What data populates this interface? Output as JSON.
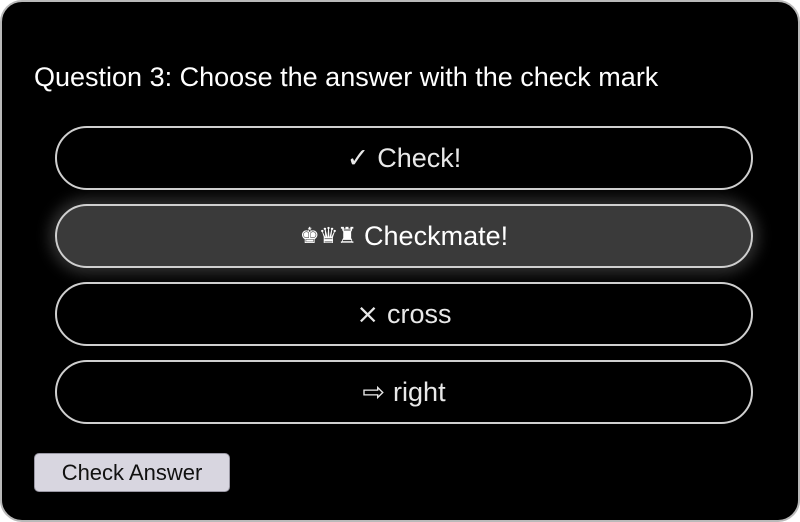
{
  "question": {
    "title": "Question 3: Choose the answer with the check mark"
  },
  "options": [
    {
      "icon": "✓",
      "icon_name": "check-mark-icon",
      "label": "Check!",
      "selected": false
    },
    {
      "icon": "♚♛♜",
      "icon_name": "chess-pieces-icon",
      "label": "Checkmate!",
      "selected": true
    },
    {
      "icon": "×",
      "icon_name": "cross-icon",
      "label": "cross",
      "selected": false
    },
    {
      "icon": "⇨",
      "icon_name": "right-arrow-icon",
      "label": "right",
      "selected": false
    }
  ],
  "actions": {
    "submit_label": "Check Answer"
  },
  "colors": {
    "background": "#000000",
    "card_border": "#b9b9b9",
    "option_border": "#cfcfcf",
    "selected_option_bg": "#3a3a3a",
    "button_bg": "#d8d6e0"
  }
}
